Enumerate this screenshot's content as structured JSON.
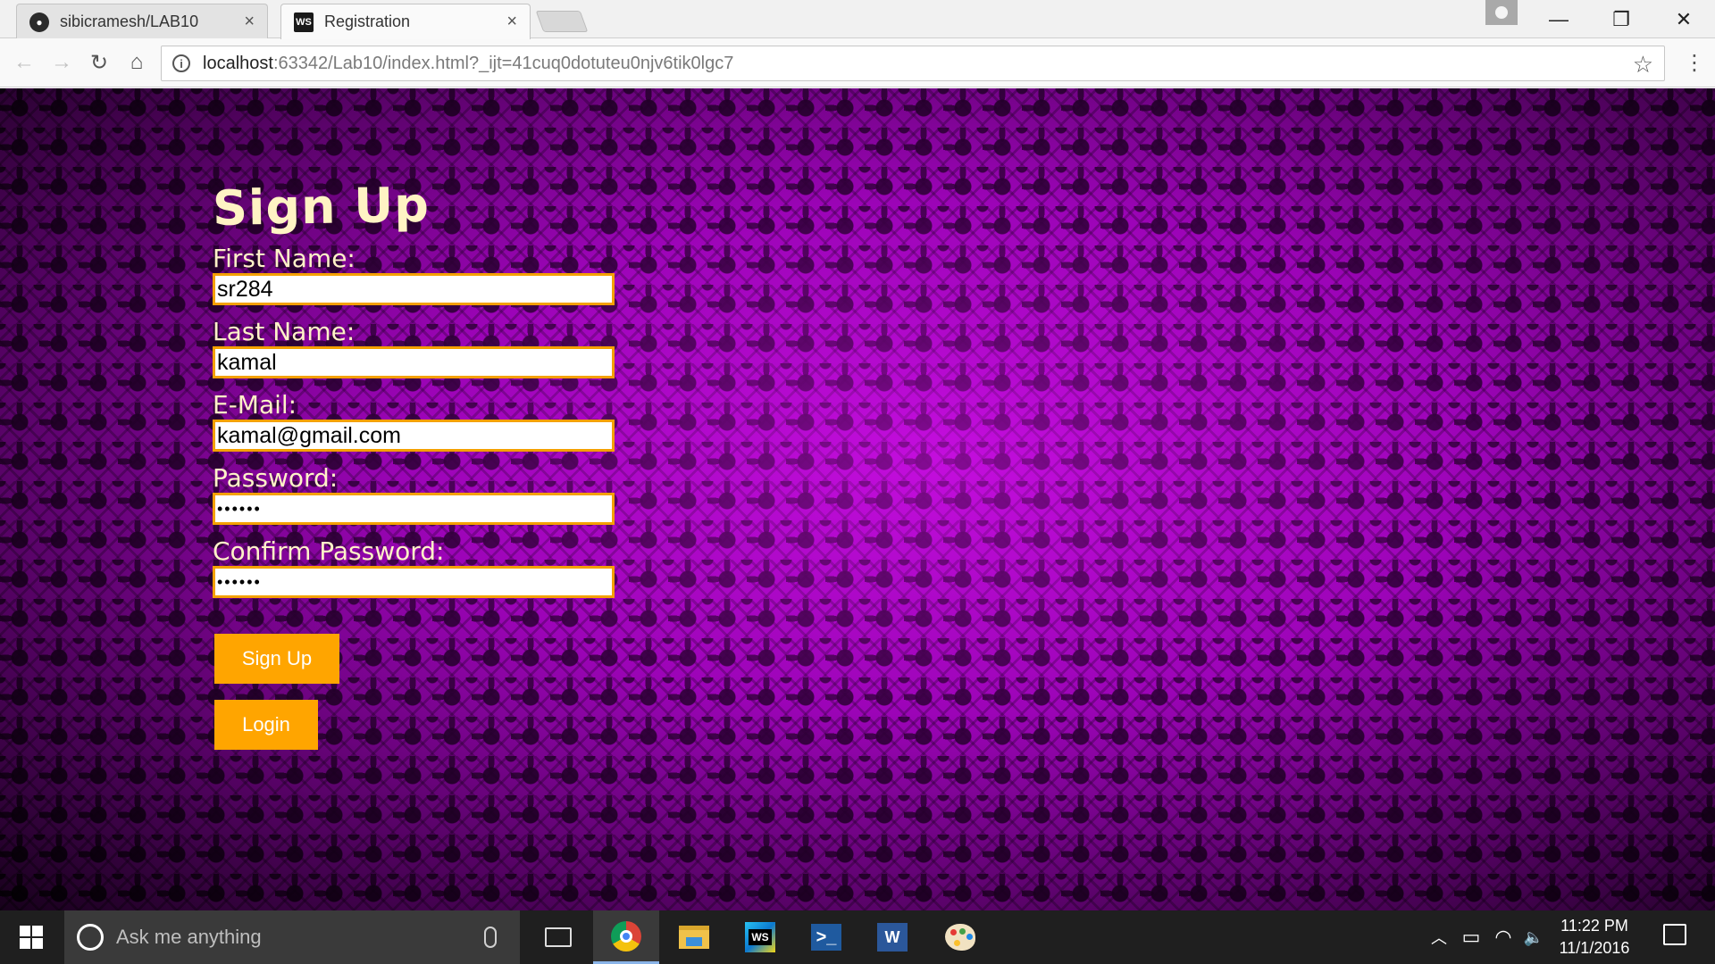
{
  "browser": {
    "tabs": [
      {
        "label": "sibicramesh/LAB10",
        "favicon": "github-icon",
        "close": "×"
      },
      {
        "label": "Registration",
        "favicon": "webstorm-icon",
        "favicon_text": "WS",
        "close": "×"
      }
    ],
    "window_controls": {
      "minimize": "—",
      "restore": "❐",
      "close": "✕"
    },
    "nav": {
      "back": "←",
      "forward": "→",
      "reload": "↻",
      "home": "⌂"
    },
    "url_host": "localhost",
    "url_rest": ":63342/Lab10/index.html?_ijt=41cuq0dotuteu0njv6tik0lgc7",
    "bookmark": "☆",
    "menu": "⋮"
  },
  "form": {
    "title": "Sign Up",
    "fields": [
      {
        "label": "First Name:",
        "value": "sr284"
      },
      {
        "label": "Last Name:",
        "value": "kamal"
      },
      {
        "label": "E-Mail:",
        "value": "kamal@gmail.com"
      },
      {
        "label": "Password:",
        "value": "••••••"
      },
      {
        "label": "Confirm Password:",
        "value": "••••••"
      }
    ],
    "signup_button": "Sign Up",
    "login_button": "Login",
    "colors": {
      "accent": "#ffa500",
      "label": "#fff2c8",
      "background": "#9a06b4"
    }
  },
  "taskbar": {
    "search_placeholder": "Ask me anything",
    "apps": [
      "task-view-icon",
      "chrome-icon",
      "file-explorer-icon",
      "webstorm-icon",
      "powershell-icon",
      "word-icon",
      "paint-icon"
    ],
    "webstorm_text": "WS",
    "powershell_text": ">_",
    "word_text": "W",
    "tray": {
      "chevron": "︿",
      "battery": "▭",
      "wifi": "◠",
      "volume": "🔈"
    },
    "time": "11:22 PM",
    "date": "11/1/2016"
  }
}
